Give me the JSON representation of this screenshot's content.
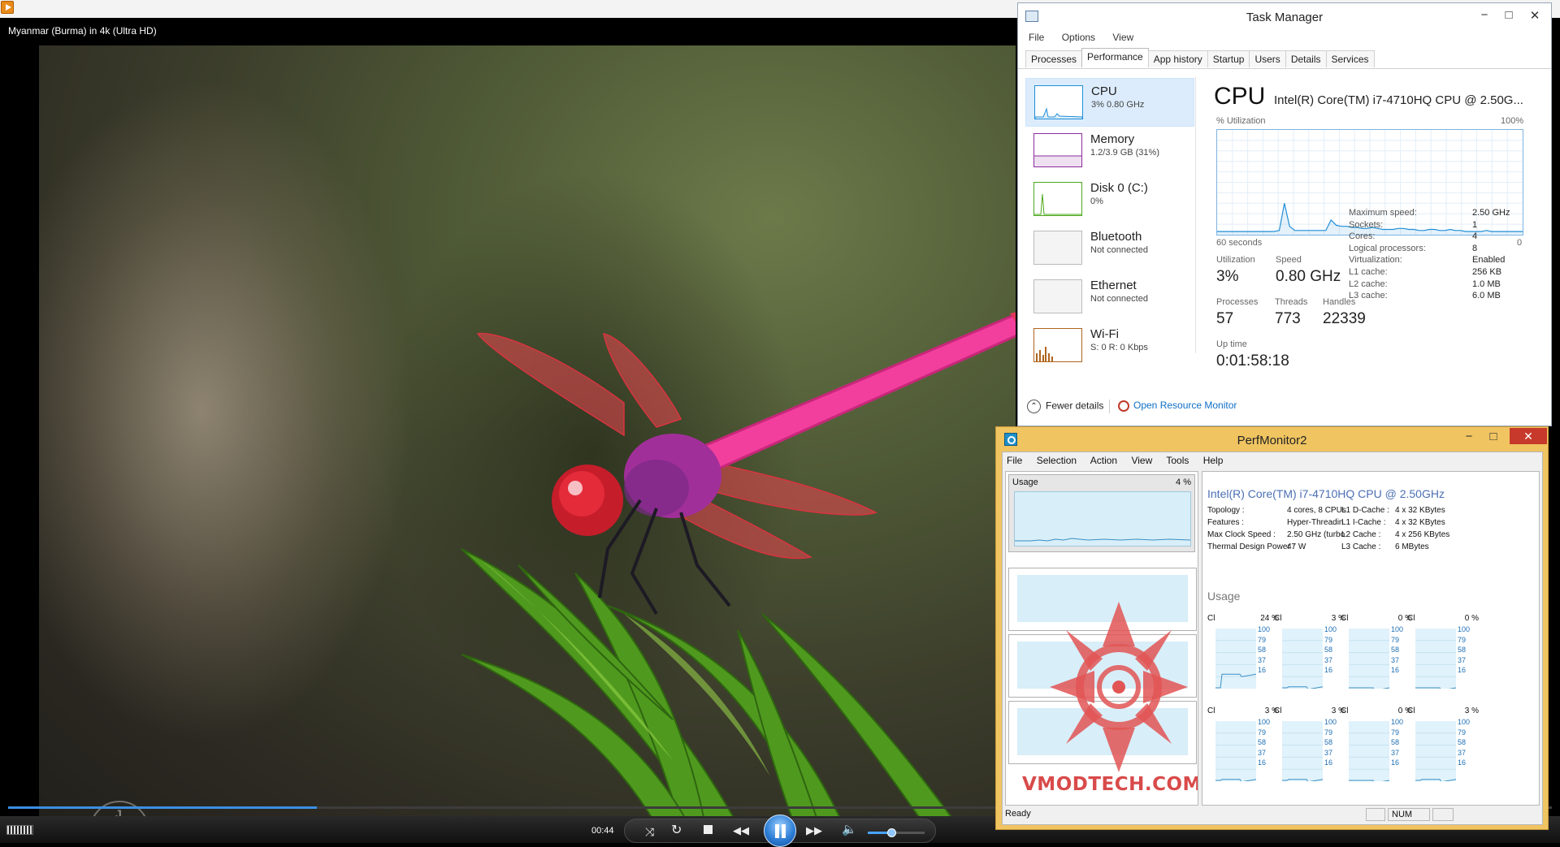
{
  "player": {
    "title": "Myanmar (Burma) in 4k (Ultra HD)",
    "time": "00:44",
    "progress_fraction": 0.2,
    "volume_fraction": 0.42,
    "watermark": [
      "J",
      "K"
    ]
  },
  "task_manager": {
    "title": "Task Manager",
    "menu": [
      "File",
      "Options",
      "View"
    ],
    "tabs": [
      "Processes",
      "Performance",
      "App history",
      "Startup",
      "Users",
      "Details",
      "Services"
    ],
    "active_tab": "Performance",
    "resources": [
      {
        "name": "CPU",
        "sub": "3% 0.80 GHz",
        "color": "#1f8ed8",
        "selected": true
      },
      {
        "name": "Memory",
        "sub": "1.2/3.9 GB (31%)",
        "color": "#8b2e9c",
        "selected": false
      },
      {
        "name": "Disk 0 (C:)",
        "sub": "0%",
        "color": "#4ca81c",
        "selected": false
      },
      {
        "name": "Bluetooth",
        "sub": "Not connected",
        "color": "#bbbbbb",
        "selected": false
      },
      {
        "name": "Ethernet",
        "sub": "Not connected",
        "color": "#bbbbbb",
        "selected": false
      },
      {
        "name": "Wi-Fi",
        "sub": "S: 0 R: 0 Kbps",
        "color": "#b0651f",
        "selected": false
      }
    ],
    "cpu_heading": "CPU",
    "cpu_model": "Intel(R) Core(TM) i7-4710HQ CPU @ 2.50G...",
    "graph_label_left": "% Utilization",
    "graph_label_right": "100%",
    "graph_bottom_left": "60 seconds",
    "graph_bottom_right": "0",
    "utilization_history": [
      3,
      3,
      3,
      3,
      3,
      3,
      3,
      3,
      3,
      3,
      3,
      3,
      4,
      30,
      8,
      4,
      4,
      4,
      4,
      4,
      4,
      4,
      14,
      9,
      8,
      8,
      7,
      7,
      6,
      6,
      7,
      6,
      5,
      5,
      5,
      6,
      6,
      5,
      5,
      4,
      4,
      5,
      5,
      4,
      4,
      5,
      4,
      4,
      3,
      3,
      3,
      3,
      4,
      3,
      3,
      3,
      3,
      3,
      3,
      3
    ],
    "stats": [
      {
        "label": "Utilization",
        "value": "3%"
      },
      {
        "label": "Speed",
        "value": "0.80 GHz"
      },
      {
        "label": "Processes",
        "value": "57"
      },
      {
        "label": "Threads",
        "value": "773"
      },
      {
        "label": "Handles",
        "value": "22339"
      },
      {
        "label": "Up time",
        "value": "0:01:58:18"
      }
    ],
    "specs": [
      {
        "label": "Maximum speed:",
        "value": "2.50 GHz"
      },
      {
        "label": "Sockets:",
        "value": "1"
      },
      {
        "label": "Cores:",
        "value": "4"
      },
      {
        "label": "Logical processors:",
        "value": "8"
      },
      {
        "label": "Virtualization:",
        "value": "Enabled"
      },
      {
        "label": "L1 cache:",
        "value": "256 KB"
      },
      {
        "label": "L2 cache:",
        "value": "1.0 MB"
      },
      {
        "label": "L3 cache:",
        "value": "6.0 MB"
      }
    ],
    "fewer_details": "Fewer details",
    "open_resource_monitor": "Open Resource Monitor"
  },
  "perfmonitor": {
    "title": "PerfMonitor2",
    "menu": [
      "File",
      "Selection",
      "Action",
      "View",
      "Tools",
      "Help"
    ],
    "usage_label": "Usage",
    "usage_pct": "4 %",
    "cpu_name": "Intel(R) Core(TM) i7-4710HQ CPU @ 2.50GHz",
    "specs_left": [
      {
        "label": "Topology :",
        "value": "4 cores, 8 CPUs"
      },
      {
        "label": "Features :",
        "value": "Hyper-Threadin"
      },
      {
        "label": "Max Clock Speed :",
        "value": "2.50 GHz (turbo"
      },
      {
        "label": "Thermal Design Power :",
        "value": "47 W"
      }
    ],
    "specs_right": [
      {
        "label": "L1 D-Cache :",
        "value": "4 x 32 KBytes"
      },
      {
        "label": "L1 I-Cache :",
        "value": "4 x 32 KBytes"
      },
      {
        "label": "L2 Cache :",
        "value": "4 x 256 KBytes"
      },
      {
        "label": "L3 Cache :",
        "value": "6 MBytes"
      }
    ],
    "usage_heading": "Usage",
    "core_axis": [
      "100",
      "79",
      "58",
      "37",
      "16"
    ],
    "cores": [
      {
        "label": "Cl",
        "pct": "24 %"
      },
      {
        "label": "Cl",
        "pct": "3 %"
      },
      {
        "label": "Cl",
        "pct": "0 %"
      },
      {
        "label": "Cl",
        "pct": "0 %"
      },
      {
        "label": "Cl",
        "pct": "3 %"
      },
      {
        "label": "Cl",
        "pct": "3 %"
      },
      {
        "label": "Cl",
        "pct": "0 %"
      },
      {
        "label": "Cl",
        "pct": "3 %"
      }
    ],
    "status": "Ready",
    "status_num": "NUM",
    "watermark_text": "VMODTECH.COM"
  }
}
